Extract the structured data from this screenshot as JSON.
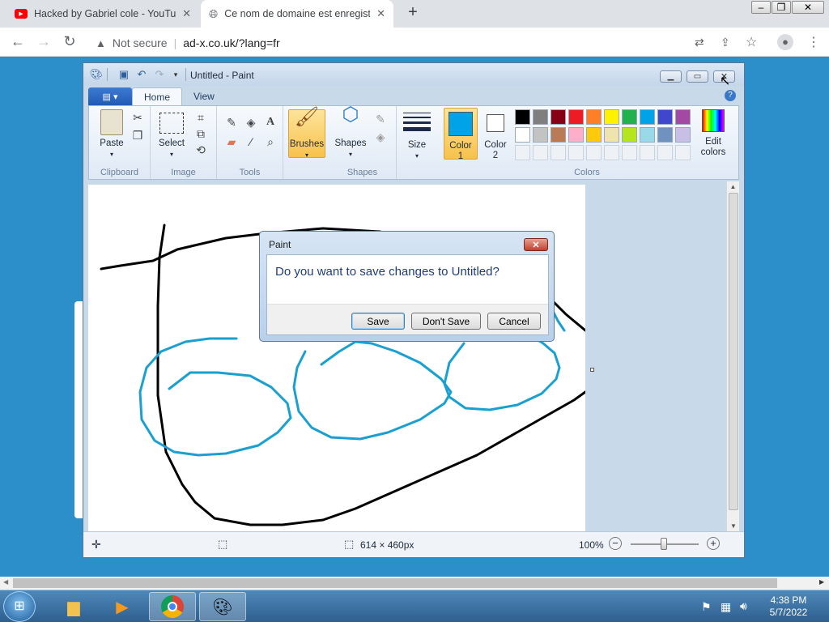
{
  "browser": {
    "tabs": [
      {
        "title": "Hacked by Gabriel cole - YouTube",
        "close": "✕"
      },
      {
        "title": "Ce nom de domaine est enregistré",
        "close": "✕"
      }
    ],
    "new_tab": "+",
    "security": "Not secure",
    "url": "ad-x.co.uk/?lang=fr",
    "window_controls": {
      "minimize": "–",
      "restore": "❐",
      "close": "✕"
    }
  },
  "paint": {
    "title": "Untitled - Paint",
    "tabs": [
      "Home",
      "View"
    ],
    "groups": {
      "clipboard": {
        "label": "Clipboard",
        "paste": "Paste"
      },
      "image": {
        "label": "Image",
        "select": "Select"
      },
      "tools": {
        "label": "Tools"
      },
      "brushes": {
        "label": "Brushes"
      },
      "shapes": {
        "label": "Shapes",
        "shapes": "Shapes"
      },
      "size": {
        "label": "Size"
      },
      "colors": {
        "label": "Colors",
        "color1": "Color",
        "color1_num": "1",
        "color2": "Color",
        "color2_num": "2",
        "edit_colors_1": "Edit",
        "edit_colors_2": "colors"
      }
    },
    "palette_row1": [
      "#000000",
      "#7f7f7f",
      "#880015",
      "#ed1c24",
      "#ff7f27",
      "#fff200",
      "#22b14c",
      "#00a2e8",
      "#3f48cc",
      "#a349a4"
    ],
    "palette_row2": [
      "#ffffff",
      "#c3c3c3",
      "#b97a57",
      "#ffaec9",
      "#ffc90e",
      "#efe4b0",
      "#b5e61d",
      "#99d9ea",
      "#7092be",
      "#c8bfe7"
    ],
    "color1_value": "#00a2e8",
    "color2_value": "#ffffff",
    "status": {
      "dimensions": "614 × 460px",
      "zoom": "100%"
    }
  },
  "dialog": {
    "title": "Paint",
    "message": "Do you want to save changes to Untitled?",
    "save": "Save",
    "dont_save": "Don't Save",
    "cancel": "Cancel"
  },
  "taskbar": {
    "time": "4:38 PM",
    "date": "5/7/2022"
  }
}
